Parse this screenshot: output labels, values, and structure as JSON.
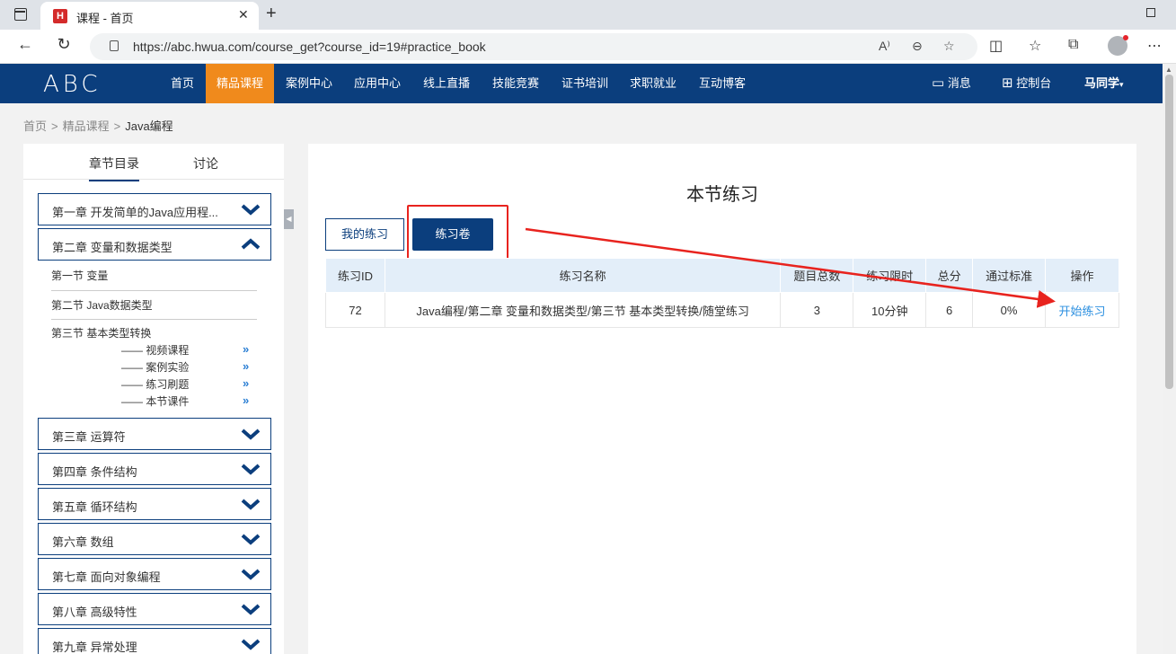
{
  "browser": {
    "tab_title": "课程 - 首页",
    "favicon": "H",
    "url": "https://abc.hwua.com/course_get?course_id=19#practice_book",
    "reader_icon": "A⁾"
  },
  "header": {
    "logo": "ABC",
    "nav": [
      "首页",
      "精品课程",
      "案例中心",
      "应用中心",
      "线上直播",
      "技能竞赛",
      "证书培训",
      "求职就业",
      "互动博客"
    ],
    "active_nav": "精品课程",
    "messages": "消息",
    "console": "控制台",
    "user": "马同学"
  },
  "breadcrumb": {
    "items": [
      "首页",
      "精品课程",
      "Java编程"
    ],
    "sep": ">"
  },
  "sidebar": {
    "tabs": [
      "章节目录",
      "讨论"
    ],
    "chapters": [
      "第一章 开发简单的Java应用程...",
      "第二章 变量和数据类型",
      "第三章 运算符",
      "第四章 条件结构",
      "第五章 循环结构",
      "第六章 数组",
      "第七章 面向对象编程",
      "第八章 高级特性",
      "第九章 异常处理"
    ],
    "sections": [
      "第一节 变量",
      "第二节 Java数据类型",
      "第三节 基本类型转换"
    ],
    "sub_items": [
      "—— 视频课程",
      "—— 案例实验",
      "—— 练习刷题",
      "—— 本节课件"
    ],
    "sub_arrow": "»"
  },
  "main": {
    "title": "本节练习",
    "btn_mine": "我的练习",
    "btn_paper": "练习卷",
    "table": {
      "headers": [
        "练习ID",
        "练习名称",
        "题目总数",
        "练习限时",
        "总分",
        "通过标准",
        "操作"
      ],
      "rows": [
        {
          "id": "72",
          "name": "Java编程/第二章 变量和数据类型/第三节 基本类型转换/随堂练习",
          "count": "3",
          "limit": "10分钟",
          "score": "6",
          "pass": "0%",
          "op": "开始练习"
        }
      ]
    }
  },
  "colors": {
    "brand": "#0b3e7d",
    "active_nav": "#f08a1c",
    "annotation": "#e8231e",
    "link": "#2b8fe0"
  }
}
